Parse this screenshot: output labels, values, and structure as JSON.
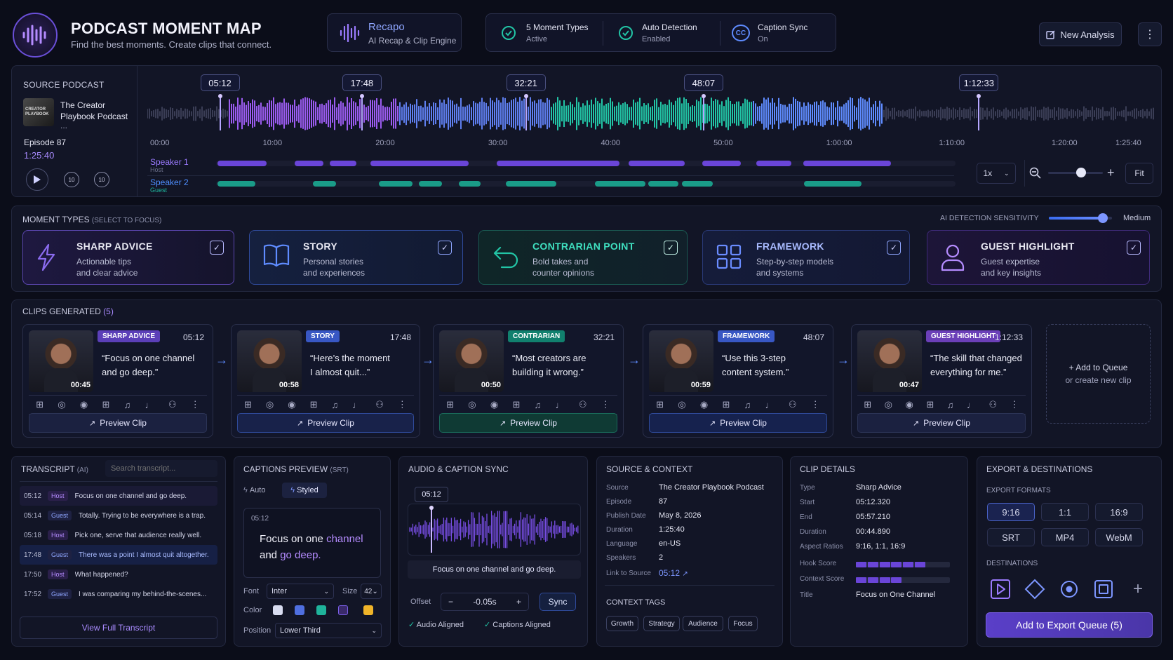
{
  "app": {
    "title": "PODCAST MOMENT MAP",
    "subtitle": "Find the best moments. Create clips that connect."
  },
  "engine": {
    "name": "Recapo",
    "desc": "AI Recap & Clip Engine"
  },
  "status": [
    {
      "title": "5 Moment Types",
      "value": "Active"
    },
    {
      "title": "Auto Detection",
      "value": "Enabled"
    },
    {
      "title": "Caption Sync",
      "value": "On"
    }
  ],
  "actions": {
    "new_analysis": "New Analysis"
  },
  "source": {
    "label": "SOURCE PODCAST",
    "show": "The Creator Playbook Podcast",
    "ellipsis": "...",
    "episode": "Episode 87",
    "duration": "1:25:40",
    "thumb_text": "CREATOR PLAYBOOK"
  },
  "timeline": {
    "markers": [
      "05:12",
      "17:48",
      "32:21",
      "48:07",
      "1:12:33"
    ],
    "ticks": [
      "00:00",
      "10:00",
      "20:00",
      "30:00",
      "40:00",
      "50:00",
      "1:00:00",
      "1:10:00",
      "1:20:00",
      "1:25:40"
    ],
    "speakers": [
      {
        "name": "Speaker 1",
        "role": "Host"
      },
      {
        "name": "Speaker 2",
        "role": "Guest"
      }
    ],
    "speed": "1x",
    "fit": "Fit",
    "zoom_level": 0.6
  },
  "moment_types": {
    "label": "MOMENT TYPES",
    "hint": "(SELECT TO FOCUS)",
    "sensitivity_label": "AI DETECTION SENSITIVITY",
    "sensitivity_value": "Medium",
    "sensitivity_level": 0.85,
    "items": [
      {
        "title": "SHARP ADVICE",
        "desc1": "Actionable tips",
        "desc2": "and clear advice",
        "icon": "lightning-icon",
        "color": "#8b6cf0"
      },
      {
        "title": "STORY",
        "desc1": "Personal stories",
        "desc2": "and experiences",
        "icon": "book-icon",
        "color": "#4f7ff0"
      },
      {
        "title": "CONTRARIAN POINT",
        "desc1": "Bold takes and",
        "desc2": "counter opinions",
        "icon": "undo-arrow-icon",
        "color": "#22c5a6"
      },
      {
        "title": "FRAMEWORK",
        "desc1": "Step-by-step models",
        "desc2": "and systems",
        "icon": "grid-icon",
        "color": "#4f7ff0"
      },
      {
        "title": "GUEST HIGHLIGHT",
        "desc1": "Guest expertise",
        "desc2": "and key insights",
        "icon": "person-icon",
        "color": "#a56cf0"
      }
    ]
  },
  "clips": {
    "label": "CLIPS GENERATED",
    "count": "(5)",
    "preview_label": "Preview Clip",
    "add_queue": "+ Add to Queue",
    "create_new": "or create new clip",
    "items": [
      {
        "tag": "SHARP ADVICE",
        "time": "05:12",
        "q1": "“Focus on one channel",
        "q2": "and go deep.”",
        "dur": "00:45",
        "color": "#5b3fb8"
      },
      {
        "tag": "STORY",
        "time": "17:48",
        "q1": "“Here’s the moment",
        "q2": "I almost quit...”",
        "dur": "00:58",
        "color": "#3857c4"
      },
      {
        "tag": "CONTRARIAN",
        "time": "32:21",
        "q1": "“Most creators are",
        "q2": "building it wrong.”",
        "dur": "00:50",
        "color": "#11806e"
      },
      {
        "tag": "FRAMEWORK",
        "time": "48:07",
        "q1": "“Use this 3-step",
        "q2": "content system.”",
        "dur": "00:59",
        "color": "#3857c4"
      },
      {
        "tag": "GUEST HIGHLIGHT",
        "time": "1:12:33",
        "q1": "“The skill that changed",
        "q2": "everything for me.”",
        "dur": "00:47",
        "color": "#6b3fb8"
      }
    ]
  },
  "transcript": {
    "label": "TRANSCRIPT",
    "ai": "(AI)",
    "search_placeholder": "Search transcript...",
    "view_full": "View Full Transcript",
    "rows": [
      {
        "time": "05:12",
        "role": "Host",
        "text": "Focus on one channel and go deep."
      },
      {
        "time": "05:14",
        "role": "Guest",
        "text": "Totally. Trying to be everywhere is a trap."
      },
      {
        "time": "05:18",
        "role": "Host",
        "text": "Pick one, serve that audience really well."
      },
      {
        "time": "17:48",
        "role": "Guest",
        "text": "There was a point I almost quit altogether."
      },
      {
        "time": "17:50",
        "role": "Host",
        "text": "What happened?"
      },
      {
        "time": "17:52",
        "role": "Guest",
        "text": "I was comparing my behind-the-scenes..."
      }
    ]
  },
  "captions": {
    "label": "CAPTIONS PREVIEW",
    "srt": "(SRT)",
    "auto": "Auto",
    "styled": "Styled",
    "time": "05:12",
    "line1a": "Focus on one ",
    "line1b": "channel",
    "line2a": "and ",
    "line2b": "go deep.",
    "font_label": "Font",
    "font": "Inter",
    "size_label": "Size",
    "size": "42",
    "color_label": "Color",
    "position_label": "Position",
    "position": "Lower Third",
    "swatches": [
      "#d8dcf0",
      "#4f6fe0",
      "#1fb39b",
      "#3a2a6a",
      "#f0b429"
    ]
  },
  "sync": {
    "label": "AUDIO & CAPTION SYNC",
    "time": "05:12",
    "caption": "Focus on one channel and go deep.",
    "offset_label": "Offset",
    "offset": "-0.05s",
    "sync_btn": "Sync",
    "audio_ok": "Audio Aligned",
    "captions_ok": "Captions Aligned"
  },
  "context": {
    "label": "SOURCE & CONTEXT",
    "fields": [
      [
        "Source",
        "The Creator Playbook Podcast"
      ],
      [
        "Episode",
        "87"
      ],
      [
        "Publish Date",
        "May 8, 2026"
      ],
      [
        "Duration",
        "1:25:40"
      ],
      [
        "Language",
        "en-US"
      ],
      [
        "Speakers",
        "2"
      ]
    ],
    "link_label": "Link to Source",
    "link_value": "05:12",
    "tags_label": "CONTEXT TAGS",
    "tags": [
      "Growth",
      "Strategy",
      "Audience",
      "Focus"
    ]
  },
  "details": {
    "label": "CLIP DETAILS",
    "fields": [
      [
        "Type",
        "Sharp Advice"
      ],
      [
        "Start",
        "05:12.320"
      ],
      [
        "End",
        "05:57.210"
      ],
      [
        "Duration",
        "00:44.890"
      ],
      [
        "Aspect Ratios",
        "9:16, 1:1, 16:9"
      ]
    ],
    "hook_label": "Hook Score",
    "hook_score": 0.78,
    "context_label": "Context Score",
    "context_score": 0.55,
    "title_label": "Title",
    "title": "Focus on One Channel"
  },
  "export": {
    "label": "EXPORT & DESTINATIONS",
    "formats_label": "EXPORT FORMATS",
    "formats": [
      "9:16",
      "1:1",
      "16:9",
      "SRT",
      "MP4",
      "WebM"
    ],
    "dest_label": "DESTINATIONS",
    "queue_btn": "Add to Export Queue (5)"
  }
}
